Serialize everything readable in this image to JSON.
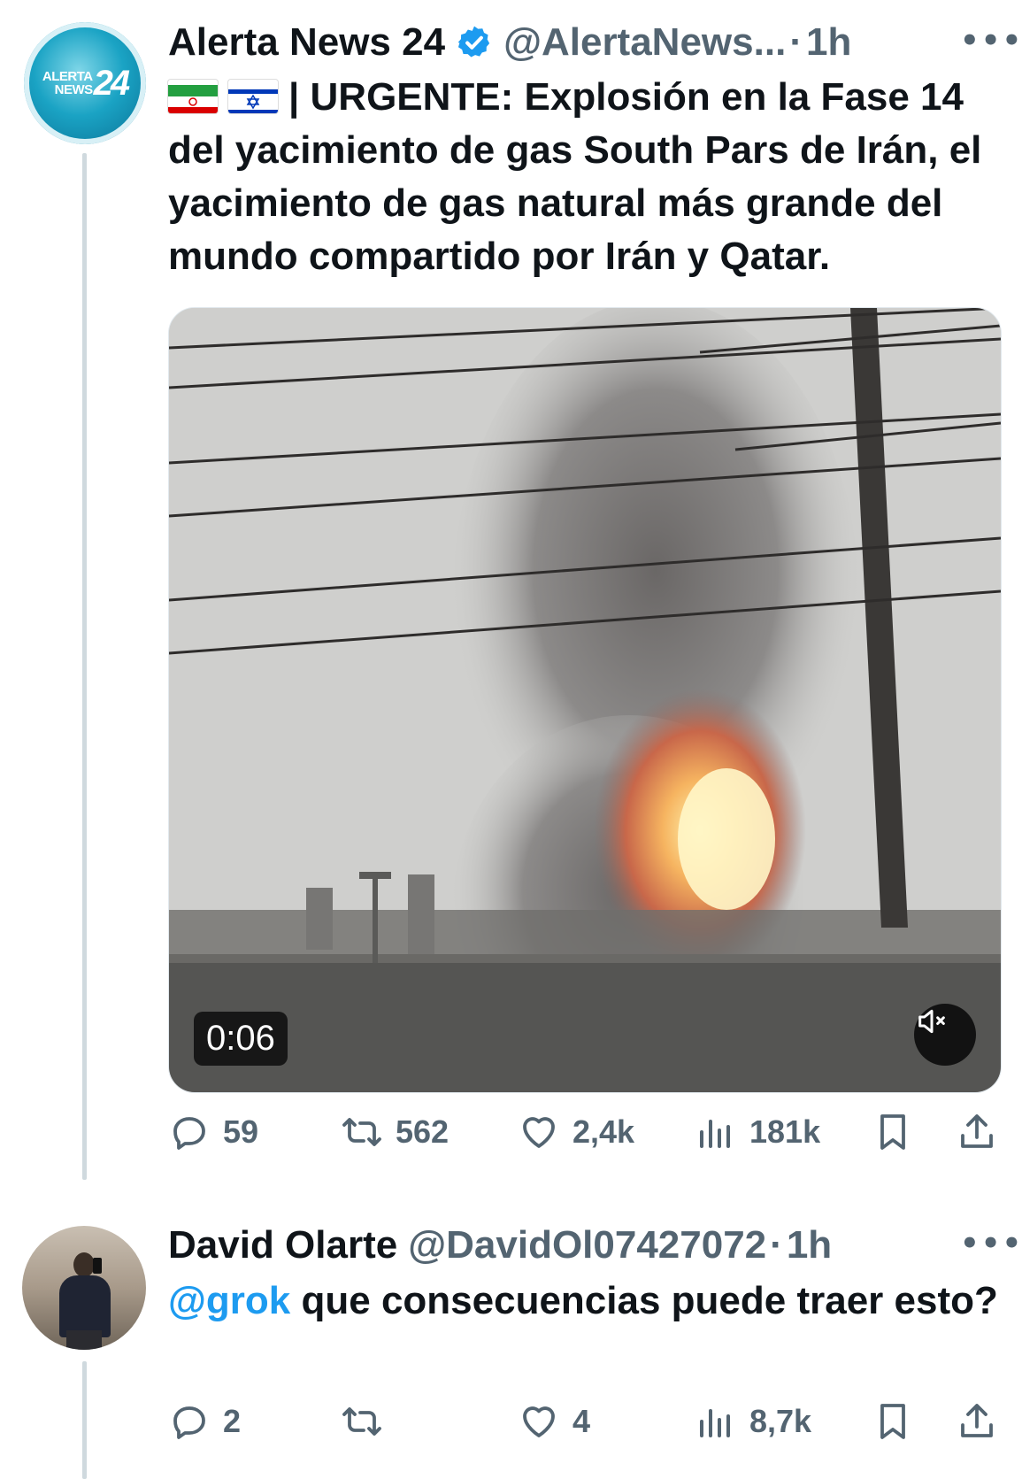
{
  "tweets": [
    {
      "author": "Alerta News 24",
      "handle": "@AlertaNews...",
      "separator": "·",
      "time": "1h",
      "verified": true,
      "avatar_lines": [
        "ALERTA",
        "NEWS",
        "24"
      ],
      "text": "| URGENTE: Explosión en la Fase 14 del yacimiento de gas South Pars de Irán, el yacimiento de gas natural más grande del mundo compartido por Irán y Qatar.",
      "flags": [
        "iran-flag",
        "israel-flag"
      ],
      "video": {
        "duration": "0:06",
        "muted": true
      },
      "stats": {
        "replies": "59",
        "reposts": "562",
        "likes": "2,4k",
        "views": "181k"
      }
    },
    {
      "author": "David Olarte",
      "handle": "@DavidOl07427072",
      "separator": "·",
      "time": "1h",
      "mention": "@grok",
      "text": " que consecuencias puede traer esto?",
      "stats": {
        "replies": "2",
        "reposts": "",
        "likes": "4",
        "views": "8,7k"
      }
    }
  ],
  "colors": {
    "text": "#0f1419",
    "secondary": "#536471",
    "link": "#1d9bf0",
    "thread_line": "#cfd9de"
  }
}
